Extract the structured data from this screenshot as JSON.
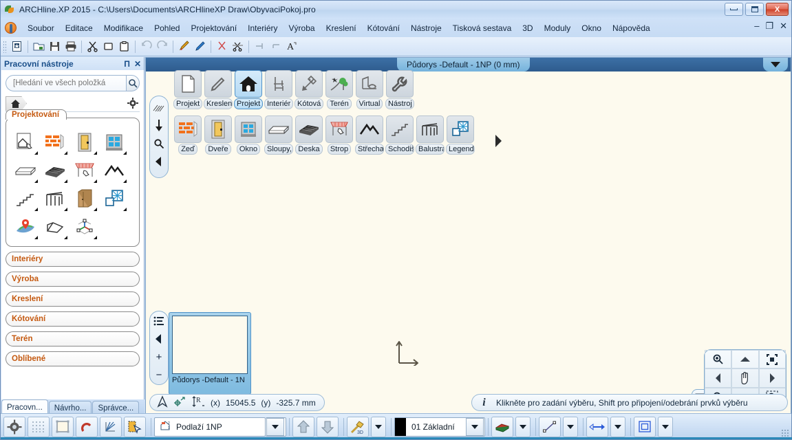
{
  "window": {
    "title": "ARCHline.XP 2015 - C:\\Users\\Documents\\ARCHlineXP Draw\\ObyvaciPokoj.pro",
    "minimize_label": "Minimalizovat",
    "maximize_label": "Maximalizovat",
    "close_label": "X"
  },
  "menubar": {
    "items": [
      "Soubor",
      "Editace",
      "Modifikace",
      "Pohled",
      "Projektování",
      "Interiéry",
      "Výroba",
      "Kreslení",
      "Kótování",
      "Nástroje",
      "Tisková sestava",
      "3D",
      "Moduly",
      "Okno",
      "Nápověda"
    ],
    "doc_minimize": "–",
    "doc_restore": "❐",
    "doc_close": "✕"
  },
  "toolbar": {
    "items": [
      {
        "name": "new-document",
        "glyph": "new"
      },
      {
        "name": "open-folder",
        "glyph": "open"
      },
      {
        "name": "save",
        "glyph": "save"
      },
      {
        "name": "print",
        "glyph": "print"
      },
      {
        "name": "cut",
        "glyph": "cut"
      },
      {
        "name": "copy",
        "glyph": "copy"
      },
      {
        "name": "paste",
        "glyph": "paste"
      },
      {
        "name": "undo",
        "glyph": "undo"
      },
      {
        "name": "redo",
        "glyph": "redo"
      },
      {
        "name": "paint-brush",
        "glyph": "brush"
      },
      {
        "name": "pencil",
        "glyph": "pencil"
      },
      {
        "name": "delete-cut",
        "glyph": "redcut"
      },
      {
        "name": "trim-scissors",
        "glyph": "scissors"
      },
      {
        "name": "trim-left",
        "glyph": "trimleft"
      },
      {
        "name": "trim-right",
        "glyph": "trimright"
      },
      {
        "name": "text-tool",
        "glyph": "text"
      }
    ]
  },
  "sidebar": {
    "title": "Pracovní nástroje",
    "pin_label": "Π",
    "close_label": "✕",
    "search": {
      "value": "",
      "placeholder": "[Hledání ve všech položká"
    },
    "groups": [
      {
        "label": "Projektování",
        "open": true,
        "icons": [
          "building-plan-icon",
          "wall-icon",
          "door-icon",
          "window-icon",
          "beam-icon",
          "slab-icon",
          "ceiling-icon",
          "roof-icon",
          "stairs-icon",
          "railing-icon",
          "cabinet-icon",
          "room-icon",
          "site-location-icon",
          "terrain-plane-icon",
          "axis-3d-icon"
        ]
      },
      {
        "label": "Interiéry",
        "open": false,
        "icons": []
      },
      {
        "label": "Výroba",
        "open": false,
        "icons": []
      },
      {
        "label": "Kreslení",
        "open": false,
        "icons": []
      },
      {
        "label": "Kótování",
        "open": false,
        "icons": []
      },
      {
        "label": "Terén",
        "open": false,
        "icons": []
      },
      {
        "label": "Oblíbené",
        "open": false,
        "icons": []
      }
    ],
    "tabs": [
      {
        "label": "Pracovn...",
        "active": true
      },
      {
        "label": "Návrho...",
        "active": false
      },
      {
        "label": "Správce...",
        "active": false
      }
    ]
  },
  "canvas": {
    "document_tab": "Půdorys -Default - 1NP (0 mm)",
    "dropdown_label": "chevron-down-icon",
    "vertical_tools": [
      "hatch-icon",
      "down-arrow-icon",
      "zoom-icon",
      "left-arrow-icon"
    ],
    "ribbon_row1": [
      {
        "label": "Projekt",
        "icon": "page-icon",
        "selected": false
      },
      {
        "label": "Kreslen",
        "icon": "pencil-icon",
        "selected": false
      },
      {
        "label": "Projekt",
        "icon": "house-icon",
        "selected": true
      },
      {
        "label": "Interiér",
        "icon": "chair-icon",
        "selected": false
      },
      {
        "label": "Kótová",
        "icon": "dimension-icon",
        "selected": false
      },
      {
        "label": "Terén",
        "icon": "tree-icon",
        "selected": false
      },
      {
        "label": "Virtual",
        "icon": "virtual-icon",
        "selected": false
      },
      {
        "label": "Nástroj",
        "icon": "wrench-icon",
        "selected": false
      }
    ],
    "ribbon_row2": [
      {
        "label": "Zeď",
        "icon": "wall-icon"
      },
      {
        "label": "Dveře",
        "icon": "door-icon"
      },
      {
        "label": "Okno",
        "icon": "window-icon"
      },
      {
        "label": "Sloupy,",
        "icon": "beam-icon"
      },
      {
        "label": "Deska",
        "icon": "slab-icon"
      },
      {
        "label": "Strop",
        "icon": "ceiling-icon"
      },
      {
        "label": "Střecha",
        "icon": "roof-icon"
      },
      {
        "label": "Schodiš",
        "icon": "stairs-icon"
      },
      {
        "label": "Balustra",
        "icon": "railing-icon"
      },
      {
        "label": "Legend",
        "icon": "legend-icon"
      }
    ],
    "more_arrow": "right-arrow-icon",
    "thumbnail": {
      "label": "Půdorys -Default - 1N"
    },
    "mini_tools": [
      "list-icon",
      "prev-icon",
      "plus-icon",
      "minus-icon"
    ],
    "navpad": [
      "zoom-in-icon",
      "pan-up-icon",
      "fit-window-icon",
      "pan-left-icon",
      "pan-hand-icon",
      "pan-right-icon",
      "zoom-out-icon",
      "pan-down-icon",
      "zoom-window-icon"
    ],
    "navpad_extra": "layout-icon"
  },
  "status": {
    "cursor_icon": "cursor-arrow-icon",
    "snap_icon": "snap-point-icon",
    "ruler_icon": "relative-coord-icon",
    "x_label": "(x)",
    "x_value": "15045.5",
    "y_label": "(y)",
    "y_value": "-325.7 mm",
    "info_icon": "info-icon",
    "message": "Klikněte pro zadání výběru, Shift pro připojení/odebrání prvků výběru"
  },
  "bottombar": {
    "buttons": [
      {
        "name": "settings-gear-button",
        "icon": "gear-icon"
      },
      {
        "name": "grid-button",
        "icon": "grid-icon"
      },
      {
        "name": "frame-button",
        "icon": "frame-icon"
      },
      {
        "name": "snap-magnet-button",
        "icon": "magnet-icon"
      },
      {
        "name": "angle-snap-button",
        "icon": "angle-icon"
      },
      {
        "name": "select-mode-button",
        "icon": "select-cursor-icon"
      }
    ],
    "floor_combo": {
      "icon": "floor-icon",
      "value": "Podlaží 1NP",
      "dropdown": "chevron-down-icon"
    },
    "floor_up": "up-arrow-icon",
    "floor_down": "down-arrow-icon",
    "tool_3d": {
      "icon": "hammer-3d-icon",
      "dropdown": "chevron-down-icon"
    },
    "layer_combo": {
      "color": "#000000",
      "value": "01 Základní",
      "dropdown": "chevron-down-icon"
    },
    "pen_combo": {
      "icon": "books-icon",
      "dropdown": "chevron-down-icon"
    },
    "line_combo": {
      "icon": "line-icon",
      "dropdown": "chevron-down-icon"
    },
    "arrow_combo": {
      "icon": "double-arrow-icon",
      "dropdown": "chevron-down-icon"
    },
    "shape_combo": {
      "icon": "square-icon",
      "dropdown": "chevron-down-icon"
    }
  }
}
